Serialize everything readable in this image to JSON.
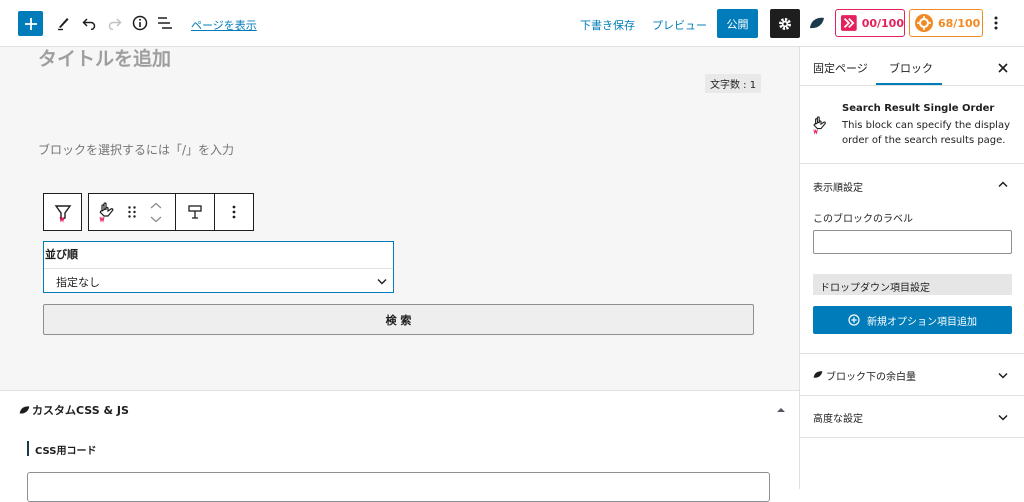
{
  "topbar": {
    "view_page_link": "ページを表示",
    "save_draft": "下書き保存",
    "preview": "プレビュー",
    "publish": "公開",
    "score_red": "00/100",
    "score_orange": "68/100",
    "colors": {
      "accent": "#007cba",
      "score_red": "#e5205c",
      "score_orange": "#f08a24",
      "settings_bg": "#1e1e1e"
    }
  },
  "editor": {
    "title_placeholder": "タイトルを追加",
    "char_count": "文字数 : 1",
    "block_placeholder": "ブロックを選択するには「/」を入力",
    "sort_label": "並び順",
    "sort_selected": "指定なし",
    "search_button": "検 索"
  },
  "metabox": {
    "title": "カスタムCSS & JS",
    "css_code_label": "CSS用コード"
  },
  "sidebar": {
    "tab_document": "固定ページ",
    "tab_block": "ブロック",
    "block_name": "Search Result Single Order",
    "block_desc_1": "This block can specify the display",
    "block_desc_2": "order of the search results page.",
    "panel_sort_title": "表示順設定",
    "block_label_caption": "このブロックのラベル",
    "block_label_value": "",
    "dropdown_settings": "ドロップダウン項目設定",
    "add_option_button": "新規オプション項目追加",
    "panel_margin_title": "ブロック下の余白量",
    "panel_advanced_title": "高度な設定"
  }
}
